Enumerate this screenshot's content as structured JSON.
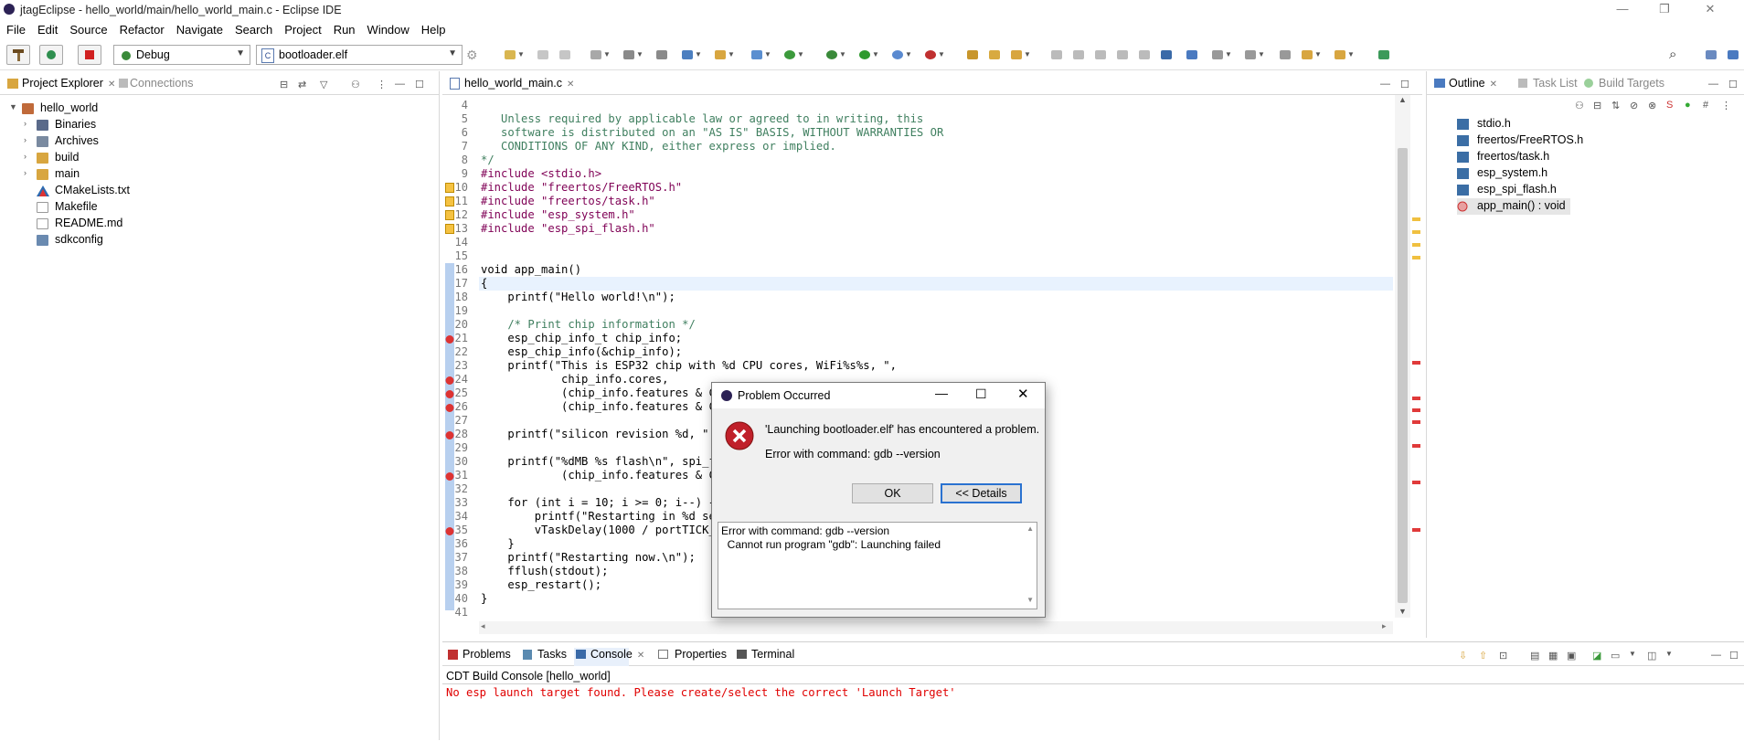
{
  "window": {
    "title": "jtagEclipse - hello_world/main/hello_world_main.c - Eclipse IDE",
    "controls": {
      "minimize": "—",
      "restore": "❐",
      "close": "✕"
    }
  },
  "menubar": [
    "File",
    "Edit",
    "Source",
    "Refactor",
    "Navigate",
    "Search",
    "Project",
    "Run",
    "Window",
    "Help"
  ],
  "toolbar": {
    "launch_mode": "Debug",
    "launch_config": "bootloader.elf",
    "launch_config_icon": "C"
  },
  "project_explorer": {
    "tabs": [
      "Project Explorer",
      "Connections"
    ],
    "tree": [
      {
        "label": "hello_world",
        "level": 0,
        "expanded": true,
        "icon": "project-icon"
      },
      {
        "label": "Binaries",
        "level": 1,
        "expandable": true,
        "icon": "binaries-icon"
      },
      {
        "label": "Archives",
        "level": 1,
        "expandable": true,
        "icon": "archives-icon"
      },
      {
        "label": "build",
        "level": 1,
        "expandable": true,
        "icon": "folder-icon"
      },
      {
        "label": "main",
        "level": 1,
        "expandable": true,
        "icon": "folder-icon"
      },
      {
        "label": "CMakeLists.txt",
        "level": 1,
        "icon": "cmake-icon"
      },
      {
        "label": "Makefile",
        "level": 1,
        "icon": "file-icon"
      },
      {
        "label": "README.md",
        "level": 1,
        "icon": "file-icon"
      },
      {
        "label": "sdkconfig",
        "level": 1,
        "icon": "config-icon"
      }
    ]
  },
  "editor": {
    "tab": "hello_world_main.c",
    "line_numbers": [
      "4",
      "5",
      "6",
      "7",
      "8",
      "9",
      "10",
      "11",
      "12",
      "13",
      "14",
      "15",
      "16",
      "17",
      "18",
      "19",
      "20",
      "21",
      "22",
      "23",
      "24",
      "25",
      "26",
      "27",
      "28",
      "29",
      "30",
      "31",
      "32",
      "33",
      "34",
      "35",
      "36",
      "37",
      "38",
      "39",
      "40",
      "41"
    ],
    "lines": [
      "",
      "   Unless required by applicable law or agreed to in writing, this",
      "   software is distributed on an \"AS IS\" BASIS, WITHOUT WARRANTIES OR",
      "   CONDITIONS OF ANY KIND, either express or implied.",
      "*/",
      "#include <stdio.h>",
      "#include \"freertos/FreeRTOS.h\"",
      "#include \"freertos/task.h\"",
      "#include \"esp_system.h\"",
      "#include \"esp_spi_flash.h\"",
      "",
      "",
      "void app_main()",
      "{",
      "    printf(\"Hello world!\\n\");",
      "",
      "    /* Print chip information */",
      "    esp_chip_info_t chip_info;",
      "    esp_chip_info(&chip_info);",
      "    printf(\"This is ESP32 chip with %d CPU cores, WiFi%s%s, \",",
      "            chip_info.cores,",
      "            (chip_info.features & CH",
      "            (chip_info.features & CH",
      "",
      "    printf(\"silicon revision %d, \",",
      "",
      "    printf(\"%dMB %s flash\\n\", spi_fl",
      "            (chip_info.features & CH",
      "",
      "    for (int i = 10; i >= 0; i--) {",
      "        printf(\"Restarting in %d sec",
      "        vTaskDelay(1000 / portTICK_P",
      "    }",
      "    printf(\"Restarting now.\\n\");",
      "    fflush(stdout);",
      "    esp_restart();",
      "}",
      ""
    ]
  },
  "outline": {
    "tabs": [
      "Outline",
      "Task List",
      "Build Targets"
    ],
    "items": [
      "stdio.h",
      "freertos/FreeRTOS.h",
      "freertos/task.h",
      "esp_system.h",
      "esp_spi_flash.h",
      "app_main() : void"
    ]
  },
  "dialog": {
    "title": "Problem Occurred",
    "message": "'Launching bootloader.elf' has encountered a problem.",
    "detail": "Error with command: gdb --version",
    "ok_label": "OK",
    "details_label": "<< Details",
    "details_text": [
      "Error with command: gdb --version",
      "  Cannot run program \"gdb\": Launching failed"
    ]
  },
  "console": {
    "tabs": [
      "Problems",
      "Tasks",
      "Console",
      "Properties",
      "Terminal"
    ],
    "header": "CDT Build Console [hello_world]",
    "message": "No esp launch target found. Please create/select the correct 'Launch Target'",
    "error_color": "#e00000"
  }
}
